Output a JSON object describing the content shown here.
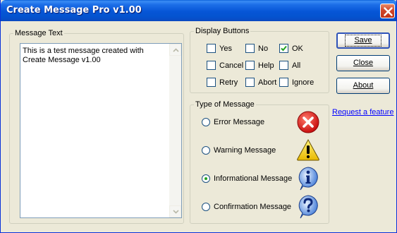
{
  "window": {
    "title": "Create Message Pro v1.00"
  },
  "message_text": {
    "group_label": "Message Text",
    "value": "This is a test message created with Create Message v1.00"
  },
  "display_buttons": {
    "group_label": "Display Buttons",
    "options": [
      {
        "label": "Yes",
        "checked": false
      },
      {
        "label": "No",
        "checked": false
      },
      {
        "label": "OK",
        "checked": true
      },
      {
        "label": "Cancel",
        "checked": false
      },
      {
        "label": "Help",
        "checked": false
      },
      {
        "label": "All",
        "checked": false
      },
      {
        "label": "Retry",
        "checked": false
      },
      {
        "label": "Abort",
        "checked": false
      },
      {
        "label": "Ignore",
        "checked": false
      }
    ]
  },
  "message_type": {
    "group_label": "Type of Message",
    "options": [
      {
        "label": "Error Message",
        "selected": false,
        "icon": "error-icon"
      },
      {
        "label": "Warning Message",
        "selected": false,
        "icon": "warning-icon"
      },
      {
        "label": "Informational Message",
        "selected": true,
        "icon": "info-icon"
      },
      {
        "label": "Confirmation Message",
        "selected": false,
        "icon": "question-icon"
      }
    ]
  },
  "actions": {
    "save": "Save",
    "close": "Close",
    "about": "About"
  },
  "request_link": "Request a feature",
  "colors": {
    "title_bar": "#0655d6",
    "dialog_bg": "#ece9d8",
    "link": "#0000ff"
  }
}
